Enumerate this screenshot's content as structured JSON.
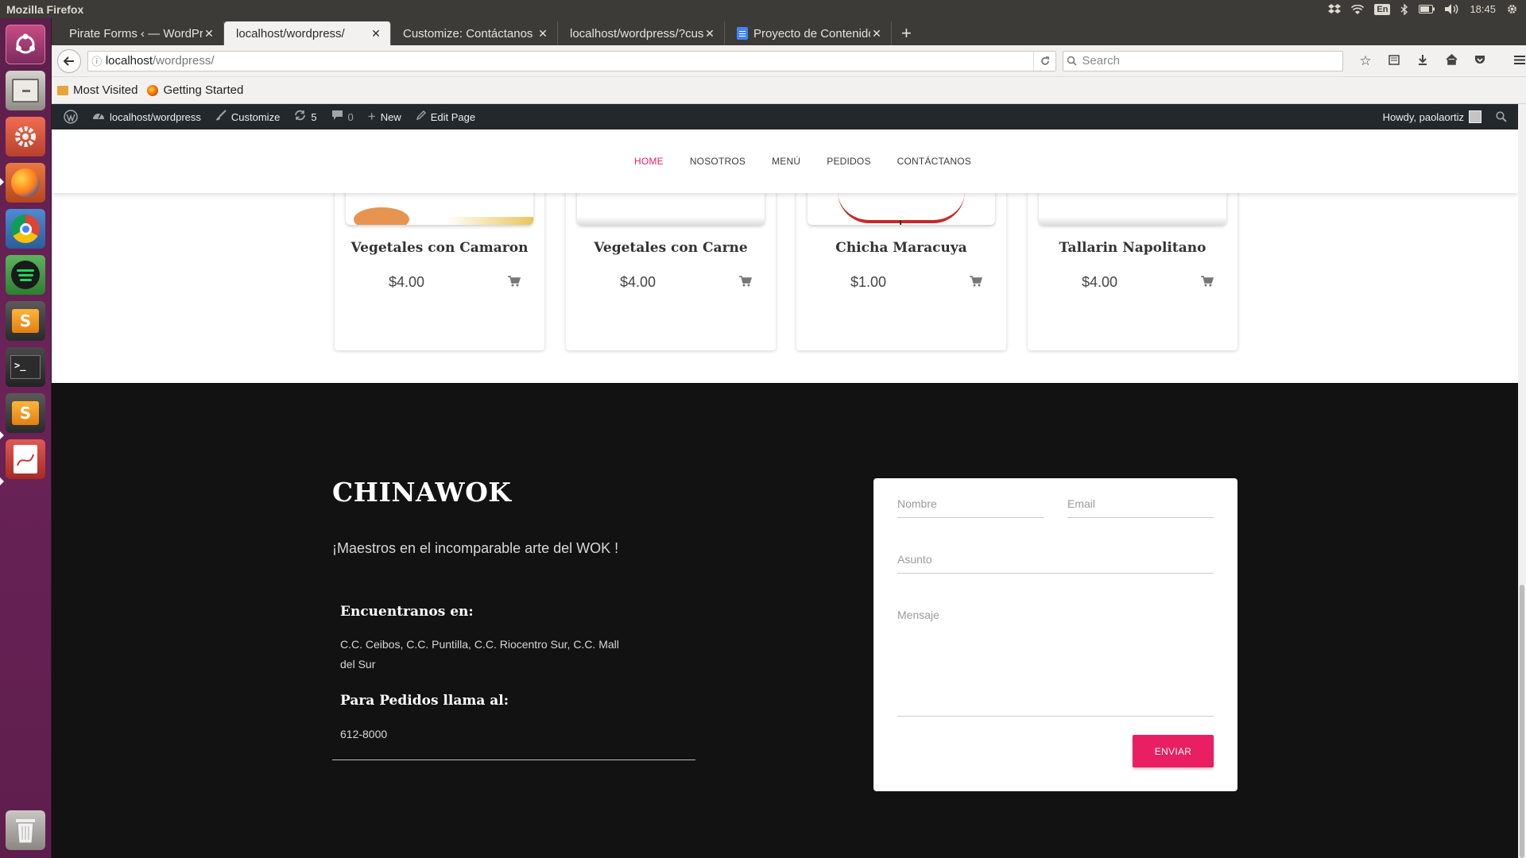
{
  "system": {
    "window_title": "Mozilla Firefox",
    "keyboard_layout": "En",
    "clock": "18:45"
  },
  "launcher": {
    "apps": [
      {
        "icon": "ubuntu-dash-icon"
      },
      {
        "icon": "files-icon"
      },
      {
        "icon": "system-settings-icon"
      },
      {
        "icon": "firefox-icon"
      },
      {
        "icon": "chrome-icon"
      },
      {
        "icon": "spotify-icon"
      },
      {
        "icon": "sublime-text-icon"
      },
      {
        "icon": "terminal-icon"
      },
      {
        "icon": "sublime-text-icon"
      },
      {
        "icon": "document-viewer-icon"
      },
      {
        "icon": "trash-icon"
      }
    ]
  },
  "browser": {
    "tabs": [
      {
        "label": "Pirate Forms ‹ — WordPre",
        "active": false
      },
      {
        "label": "localhost/wordpress/",
        "active": true
      },
      {
        "label": "Customize: Contáctanos",
        "active": false
      },
      {
        "label": "localhost/wordpress/?cus",
        "active": false
      },
      {
        "label": "Proyecto de Contenido",
        "active": false
      }
    ],
    "url_host": "localhost",
    "url_path": "/wordpress/",
    "search_placeholder": "Search",
    "bookmarks": [
      {
        "label": "Most Visited"
      },
      {
        "label": "Getting Started"
      }
    ]
  },
  "wp_admin_bar": {
    "site": "localhost/wordpress",
    "customize": "Customize",
    "updates_count": "5",
    "comments_count": "0",
    "new": "New",
    "edit_page": "Edit Page",
    "howdy": "Howdy, paolaortiz"
  },
  "nav": {
    "items": [
      "HOME",
      "NOSOTROS",
      "MENÚ",
      "PEDIDOS",
      "CONTÁCTANOS"
    ],
    "active": "HOME",
    "accent_color": "#e91e63"
  },
  "products": [
    {
      "name": "Vegetales con Camaron",
      "price": "$4.00"
    },
    {
      "name": "Vegetales con Carne",
      "price": "$4.00"
    },
    {
      "name": "Chicha Maracuya",
      "price": "$1.00"
    },
    {
      "name": "Tallarin Napolitano",
      "price": "$4.00"
    }
  ],
  "footer": {
    "title": "CHINAWOK",
    "tagline": "¡Maestros en el incomparable arte del WOK !",
    "locations_heading": "Encuentranos en:",
    "locations": "C.C. Ceibos, C.C. Puntilla, C.C. Riocentro Sur, C.C. Mall del Sur",
    "phone_heading": "Para Pedidos llama al:",
    "phone": "612-8000"
  },
  "contact_form": {
    "nombre_placeholder": "Nombre",
    "email_placeholder": "Email",
    "asunto_placeholder": "Asunto",
    "mensaje_placeholder": "Mensaje",
    "submit_label": "ENVIAR"
  }
}
